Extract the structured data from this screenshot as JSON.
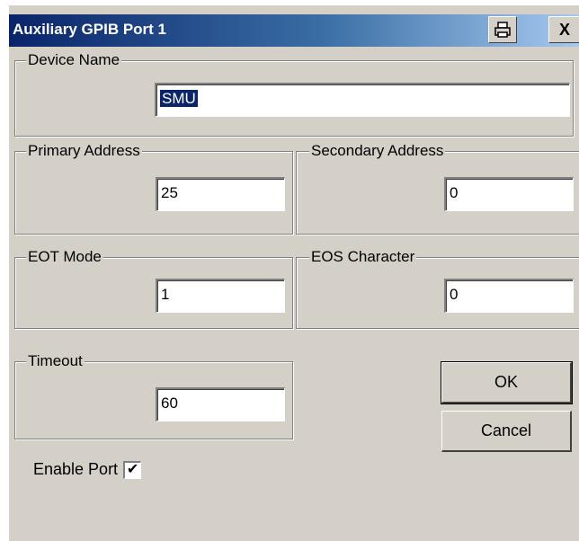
{
  "window": {
    "title": "Auxiliary GPIB Port 1",
    "print_icon": "printer-icon",
    "close_label": "X"
  },
  "device_name": {
    "label": "Device Name",
    "value": "SMU"
  },
  "primary_address": {
    "label": "Primary Address",
    "value": "25"
  },
  "secondary_address": {
    "label": "Secondary Address",
    "value": "0"
  },
  "eot_mode": {
    "label": "EOT Mode",
    "value": "1"
  },
  "eos_character": {
    "label": "EOS Character",
    "value": "0"
  },
  "timeout": {
    "label": "Timeout",
    "value": "60"
  },
  "buttons": {
    "ok": "OK",
    "cancel": "Cancel"
  },
  "enable_port": {
    "label": "Enable Port",
    "checked": true,
    "check_glyph": "✔"
  },
  "colors": {
    "title_start": "#0a246a",
    "title_end": "#a6caf0",
    "face": "#d4d0c8"
  }
}
